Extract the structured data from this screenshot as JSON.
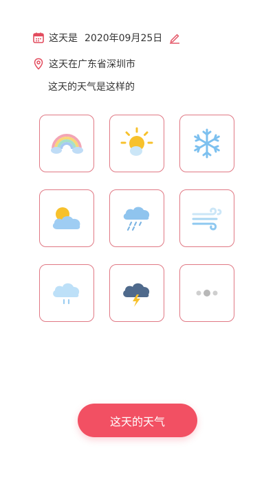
{
  "header": {
    "date_label": "这天是",
    "date_value": "2020年09月25日",
    "location_text": "这天在广东省深圳市",
    "weather_prompt": "这天的天气是这样的"
  },
  "weather_options": [
    {
      "icon": "rainbow-icon"
    },
    {
      "icon": "sunny-icon"
    },
    {
      "icon": "snowflake-icon"
    },
    {
      "icon": "partly-cloudy-icon"
    },
    {
      "icon": "rain-cloud-icon"
    },
    {
      "icon": "wind-icon"
    },
    {
      "icon": "drizzle-cloud-icon"
    },
    {
      "icon": "thunderstorm-icon"
    },
    {
      "icon": "more-icon"
    }
  ],
  "submit_button": {
    "label": "这天的天气"
  },
  "colors": {
    "accent": "#f25063",
    "cell_border": "#e07783",
    "calendar_icon": "#e24c5e"
  }
}
